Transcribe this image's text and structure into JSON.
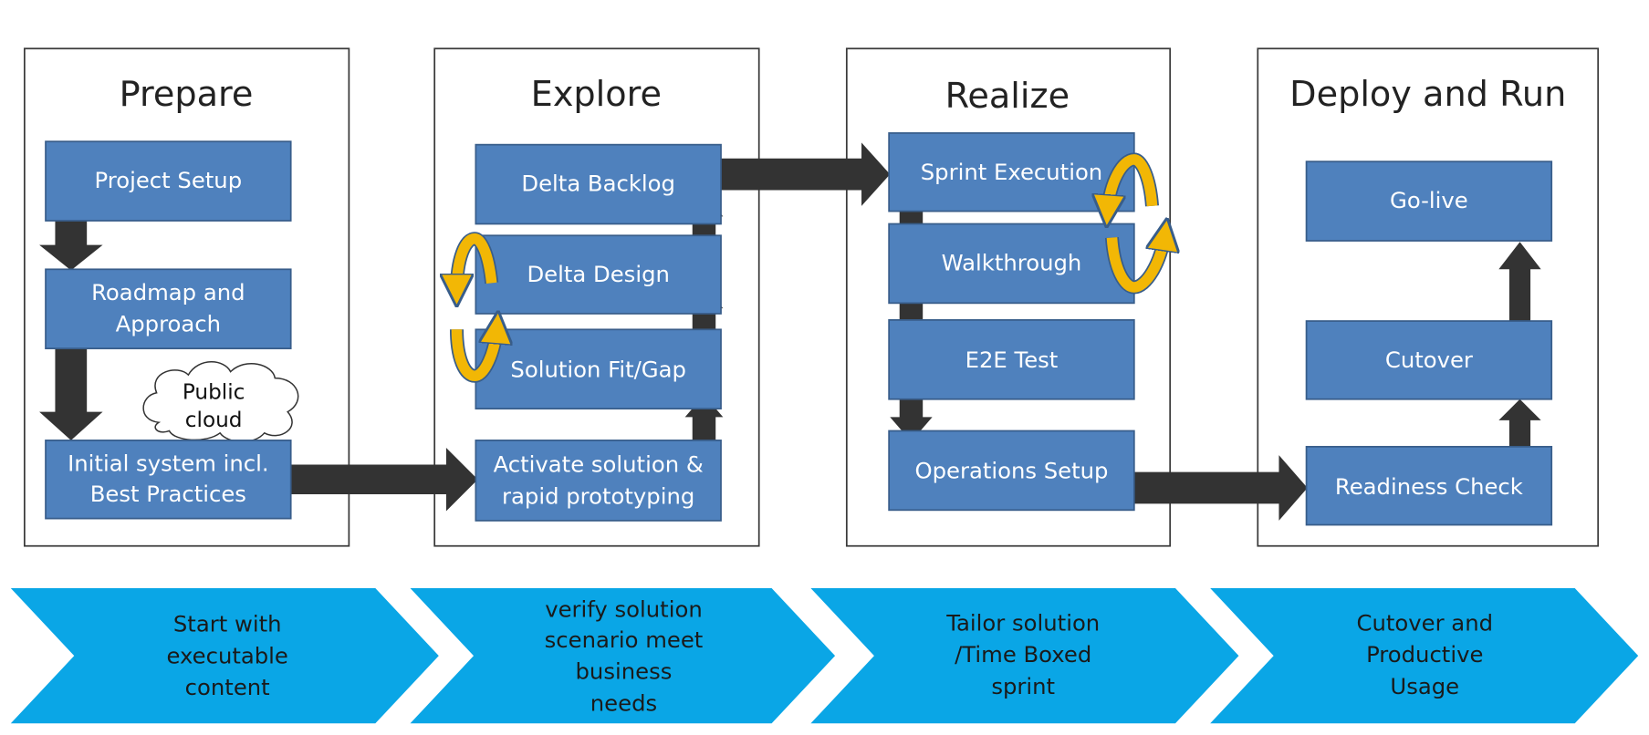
{
  "colors": {
    "box": "#4F81BD",
    "box_border": "#385D8A",
    "arrow": "#333333",
    "cycle_arrow": "#F2B705",
    "chevron": "#0AA6E6"
  },
  "phases": [
    {
      "title": "Prepare",
      "boxes": [
        [
          "Project Setup"
        ],
        [
          "Roadmap and",
          "Approach"
        ],
        [
          "Initial system incl.",
          "Best Practices"
        ]
      ],
      "cloud": [
        "Public",
        "cloud"
      ],
      "chevron": [
        "Start with",
        "executable",
        "content"
      ]
    },
    {
      "title": "Explore",
      "boxes": [
        [
          "Delta Backlog"
        ],
        [
          "Delta Design"
        ],
        [
          "Solution Fit/Gap"
        ],
        [
          "Activate solution &",
          "rapid prototyping"
        ]
      ],
      "chevron": [
        "verify solution",
        "scenario meet",
        "business",
        "needs"
      ]
    },
    {
      "title": "Realize",
      "boxes": [
        [
          "Sprint Execution"
        ],
        [
          "Walkthrough"
        ],
        [
          "E2E Test"
        ],
        [
          "Operations Setup"
        ]
      ],
      "chevron": [
        "Tailor solution",
        "/Time Boxed",
        "sprint"
      ]
    },
    {
      "title": "Deploy and Run",
      "boxes": [
        [
          "Go-live"
        ],
        [
          "Cutover"
        ],
        [
          "Readiness Check"
        ]
      ],
      "chevron": [
        "Cutover and",
        "Productive",
        "Usage"
      ]
    }
  ]
}
